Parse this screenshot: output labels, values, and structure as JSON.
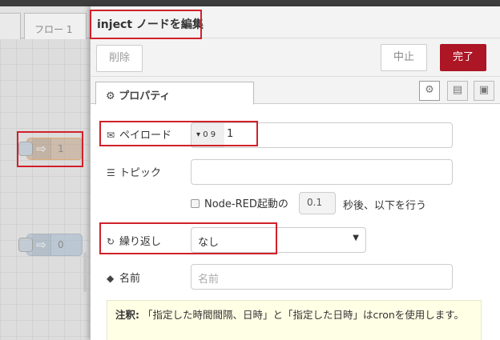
{
  "workspace": {
    "tab_label": "フロー 1",
    "nodes": [
      {
        "label": "1"
      },
      {
        "label": "0"
      }
    ]
  },
  "tray": {
    "title": "inject ノードを編集",
    "delete_label": "削除",
    "cancel_label": "中止",
    "done_label": "完了",
    "properties_tab": "プロパティ",
    "icons": {
      "properties": "gear-icon",
      "description": "document-icon",
      "appearance": "frame-icon"
    }
  },
  "form": {
    "payload_label": "ペイロード",
    "payload_type_label": "0 9",
    "payload_value": "1",
    "topic_label": "トピック",
    "topic_value": "",
    "inject_once_label": "Node-RED起動の",
    "inject_once_delay": "0.1",
    "inject_once_after": "秒後、以下を行う",
    "repeat_label": "繰り返し",
    "repeat_value": "なし",
    "name_label": "名前",
    "name_placeholder": "名前"
  },
  "note": {
    "bold": "注釈:",
    "text": " 「指定した時間間隔、日時」と「指定した日時」はcronを使用します。"
  },
  "colors": {
    "highlight": "#d1212b",
    "done_button": "#ad1625"
  }
}
